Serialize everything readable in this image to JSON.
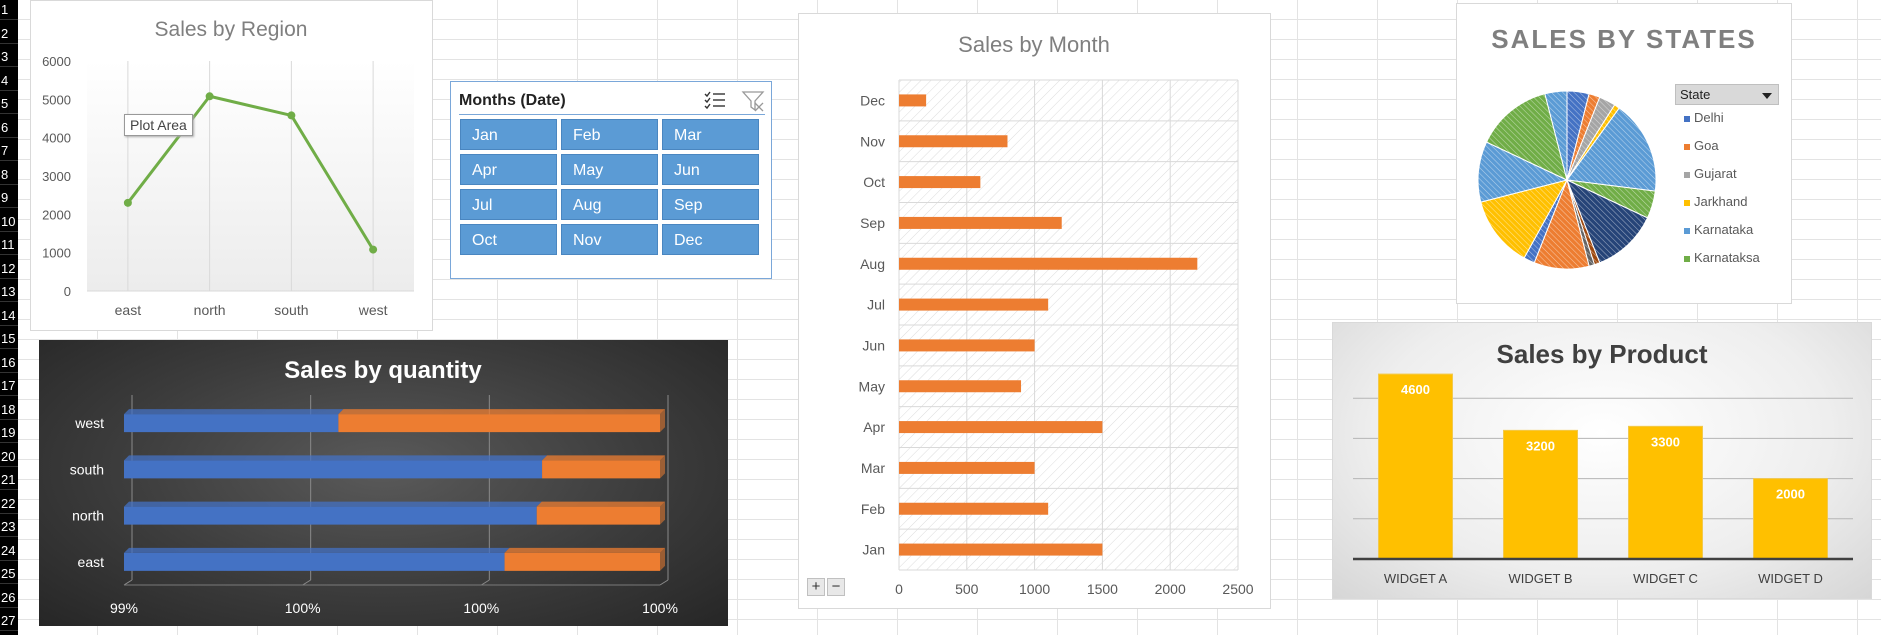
{
  "sheet": {
    "row_numbers": [
      "1",
      "2",
      "3",
      "4",
      "5",
      "6",
      "7",
      "8",
      "9",
      "10",
      "11",
      "12",
      "13",
      "14",
      "15",
      "16",
      "17",
      "18",
      "19",
      "20",
      "21",
      "22",
      "23",
      "24",
      "25",
      "26",
      "27"
    ]
  },
  "region_chart": {
    "tooltip": "Plot Area"
  },
  "slicer": {
    "title": "Months (Date)",
    "items": [
      "Jan",
      "Feb",
      "Mar",
      "Apr",
      "May",
      "Jun",
      "Jul",
      "Aug",
      "Sep",
      "Oct",
      "Nov",
      "Dec"
    ],
    "multiselect_icon": "multi-select-icon",
    "clear_filter_icon": "clear-filter-icon"
  },
  "month_chart_controls": {
    "expand": "+",
    "collapse": "−"
  },
  "state_filter": {
    "label": "State"
  },
  "colors": {
    "line_green": "#70ad47",
    "bar_orange": "#ed7d31",
    "bar_blue": "#4472c4",
    "bar_gold": "#ffc000",
    "slicer_blue": "#5b9bd5"
  },
  "chart_data": [
    {
      "type": "line",
      "title": "Sales by Region",
      "categories": [
        "east",
        "north",
        "south",
        "west"
      ],
      "values": [
        2300,
        5080,
        4580,
        1080
      ],
      "y_ticks": [
        "0",
        "1000",
        "2000",
        "3000",
        "4000",
        "5000",
        "6000"
      ],
      "ylim": [
        0,
        6000
      ],
      "grid": "vertical"
    },
    {
      "type": "bar",
      "orientation": "horizontal",
      "title": "Sales by Month",
      "categories": [
        "Jan",
        "Feb",
        "Mar",
        "Apr",
        "May",
        "Jun",
        "Jul",
        "Aug",
        "Sep",
        "Oct",
        "Nov",
        "Dec"
      ],
      "values": [
        1500,
        1100,
        1000,
        1500,
        900,
        1000,
        1100,
        2200,
        1200,
        600,
        800,
        200
      ],
      "x_ticks": [
        "0",
        "500",
        "1000",
        "1500",
        "2000",
        "2500"
      ],
      "xlim": [
        0,
        2500
      ]
    },
    {
      "type": "pie",
      "title": "SALES BY STATES",
      "legend_title": "State",
      "legend": [
        "Delhi",
        "Goa",
        "Gujarat",
        "Jarkhand",
        "Karnataka",
        "Karnataksa"
      ],
      "legend_colors": [
        "#4472c4",
        "#ed7d31",
        "#a5a5a5",
        "#ffc000",
        "#5b9bd5",
        "#70ad47"
      ],
      "slices": [
        {
          "color": "#4472c4",
          "value": 4
        },
        {
          "color": "#ed7d31",
          "value": 2
        },
        {
          "color": "#a5a5a5",
          "value": 3
        },
        {
          "color": "#ffc000",
          "value": 1
        },
        {
          "color": "#5b9bd5",
          "value": 17
        },
        {
          "color": "#70ad47",
          "value": 5
        },
        {
          "color": "#264478",
          "value": 12
        },
        {
          "color": "#9e480e",
          "value": 1
        },
        {
          "color": "#636363",
          "value": 1
        },
        {
          "color": "#ed7d31",
          "value": 10
        },
        {
          "color": "#4472c4",
          "value": 2
        },
        {
          "color": "#ffc000",
          "value": 13
        },
        {
          "color": "#5b9bd5",
          "value": 11
        },
        {
          "color": "#70ad47",
          "value": 14
        },
        {
          "color": "#5b9bd5",
          "value": 4
        }
      ]
    },
    {
      "type": "bar",
      "orientation": "horizontal-stacked-100",
      "title": "Sales by quantity",
      "categories": [
        "east",
        "north",
        "south",
        "west"
      ],
      "series": [
        {
          "color": "#4472c4",
          "values": [
            71,
            77,
            78,
            40
          ]
        },
        {
          "color": "#ed7d31",
          "values": [
            29,
            23,
            22,
            60
          ]
        }
      ],
      "x_ticks": [
        "99%",
        "100%",
        "100%",
        "100%"
      ]
    },
    {
      "type": "bar",
      "title": "Sales by Product",
      "categories": [
        "WIDGET A",
        "WIDGET B",
        "WIDGET C",
        "WIDGET D"
      ],
      "values": [
        4600,
        3200,
        3300,
        2000
      ],
      "data_labels": [
        "4600",
        "3200",
        "3300",
        "2000"
      ],
      "ylim": [
        0,
        5000
      ]
    }
  ]
}
